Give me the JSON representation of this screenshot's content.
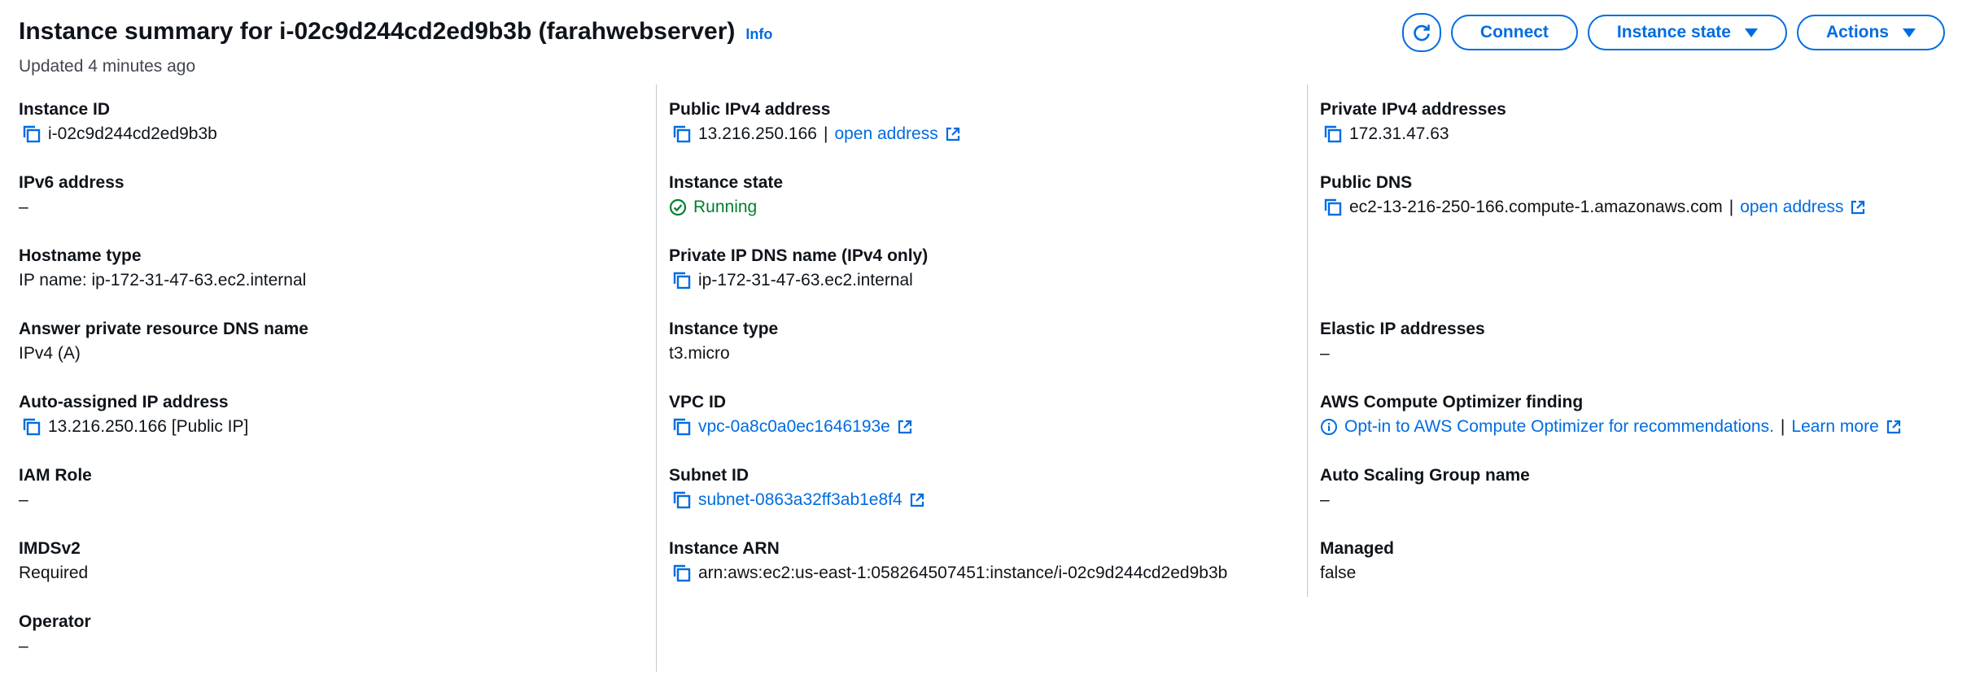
{
  "header": {
    "title": "Instance summary for i-02c9d244cd2ed9b3b (farahwebserver)",
    "info_label": "Info",
    "updated": "Updated 4 minutes ago"
  },
  "actions": {
    "connect_label": "Connect",
    "instance_state_label": "Instance state",
    "actions_label": "Actions"
  },
  "col1": {
    "instance_id": {
      "label": "Instance ID",
      "value": "i-02c9d244cd2ed9b3b"
    },
    "ipv6": {
      "label": "IPv6 address",
      "value": "–"
    },
    "hostname_type": {
      "label": "Hostname type",
      "value": "IP name: ip-172-31-47-63.ec2.internal"
    },
    "answer_dns": {
      "label": "Answer private resource DNS name",
      "value": "IPv4 (A)"
    },
    "auto_ip": {
      "label": "Auto-assigned IP address",
      "value": "13.216.250.166 [Public IP]"
    },
    "iam_role": {
      "label": "IAM Role",
      "value": "–"
    },
    "imdsv2": {
      "label": "IMDSv2",
      "value": "Required"
    },
    "operator": {
      "label": "Operator",
      "value": "–"
    }
  },
  "col2": {
    "public_ipv4": {
      "label": "Public IPv4 address",
      "value": "13.216.250.166",
      "link": "open address"
    },
    "instance_state": {
      "label": "Instance state",
      "value": "Running"
    },
    "private_dns": {
      "label": "Private IP DNS name (IPv4 only)",
      "value": "ip-172-31-47-63.ec2.internal"
    },
    "instance_type": {
      "label": "Instance type",
      "value": "t3.micro"
    },
    "vpc_id": {
      "label": "VPC ID",
      "value": "vpc-0a8c0a0ec1646193e"
    },
    "subnet_id": {
      "label": "Subnet ID",
      "value": "subnet-0863a32ff3ab1e8f4"
    },
    "arn": {
      "label": "Instance ARN",
      "value": "arn:aws:ec2:us-east-1:058264507451:instance/i-02c9d244cd2ed9b3b"
    }
  },
  "col3": {
    "private_ipv4": {
      "label": "Private IPv4 addresses",
      "value": "172.31.47.63"
    },
    "public_dns": {
      "label": "Public DNS",
      "value": "ec2-13-216-250-166.compute-1.amazonaws.com",
      "link": "open address"
    },
    "elastic_ip": {
      "label": "Elastic IP addresses",
      "value": "–"
    },
    "optimizer": {
      "label": "AWS Compute Optimizer finding",
      "value": "Opt-in to AWS Compute Optimizer for recommendations.",
      "link": "Learn more"
    },
    "asg": {
      "label": "Auto Scaling Group name",
      "value": "–"
    },
    "managed": {
      "label": "Managed",
      "value": "false"
    }
  },
  "colors": {
    "link": "#006ce0",
    "running": "#00802f",
    "text": "#0f141a",
    "muted": "#424650",
    "divider": "#c6c6cd"
  }
}
